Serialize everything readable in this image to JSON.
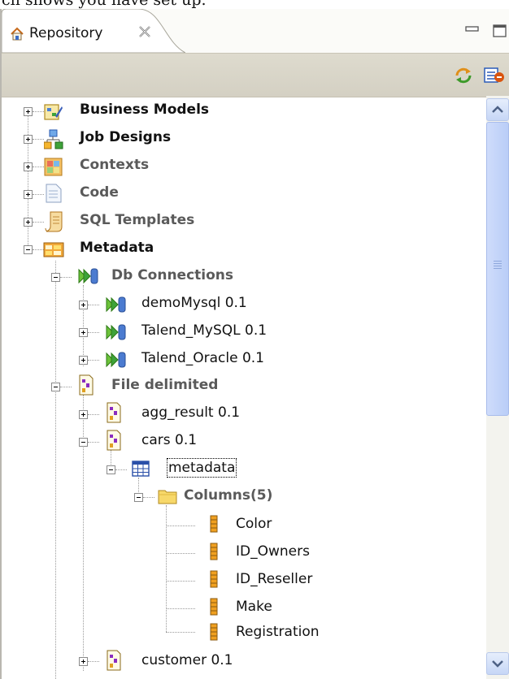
{
  "window": {
    "clipped_heading": "ch shows you have set up."
  },
  "tab": {
    "title": "Repository"
  },
  "toolbar": {
    "buttons": [
      {
        "icon": "refresh-sync-icon"
      },
      {
        "icon": "view-menu-icon"
      }
    ]
  },
  "tree": {
    "business_models": "Business Models",
    "job_designs": "Job Designs",
    "contexts": "Contexts",
    "code": "Code",
    "sql_templates": "SQL Templates",
    "metadata": "Metadata",
    "db_connections": "Db Connections",
    "db_items": [
      "demoMysql 0.1",
      "Talend_MySQL 0.1",
      "Talend_Oracle 0.1"
    ],
    "file_delimited": "File delimited",
    "file_items": [
      "agg_result 0.1",
      "cars 0.1"
    ],
    "cars_metadata": "metadata",
    "columns": "Columns(5)",
    "column_items": [
      "Color",
      "ID_Owners",
      "ID_Reseller",
      "Make",
      "Registration"
    ],
    "customer": "customer 0.1"
  },
  "colors": {
    "toolbar_bg": "#d4d0c3",
    "scrollbar_accent": "#b9cdf7"
  }
}
